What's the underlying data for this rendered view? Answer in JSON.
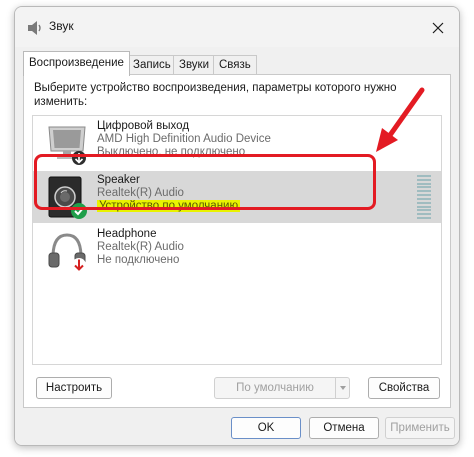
{
  "window": {
    "title": "Звук"
  },
  "tabs": [
    {
      "label": "Воспроизведение",
      "active": true
    },
    {
      "label": "Запись",
      "active": false
    },
    {
      "label": "Звуки",
      "active": false
    },
    {
      "label": "Связь",
      "active": false
    }
  ],
  "panel": {
    "instruction": "Выберите устройство воспроизведения, параметры которого нужно изменить:"
  },
  "devices": [
    {
      "name": "Цифровой выход",
      "driver": "AMD High Definition Audio Device",
      "status": "Выключено, не подключено",
      "icon": "monitor-icon",
      "badge": "down-arrow-badge-icon"
    },
    {
      "name": "Speaker",
      "driver": "Realtek(R) Audio",
      "status": "Устройство по умолчанию",
      "icon": "speaker-icon",
      "badge": "checkmark-badge-icon",
      "selected": true
    },
    {
      "name": "Headphone",
      "driver": "Realtek(R) Audio",
      "status": "Не подключено",
      "icon": "headphones-icon",
      "badge": "red-down-arrow-badge-icon"
    }
  ],
  "buttons": {
    "configure": "Настроить",
    "set_default": "По умолчанию",
    "properties": "Свойства",
    "ok": "OK",
    "cancel": "Отмена",
    "apply": "Применить"
  },
  "colors": {
    "annotation_red": "#e31b23",
    "status_highlight": "#e9f200",
    "selected_row": "#d8d8d8"
  }
}
